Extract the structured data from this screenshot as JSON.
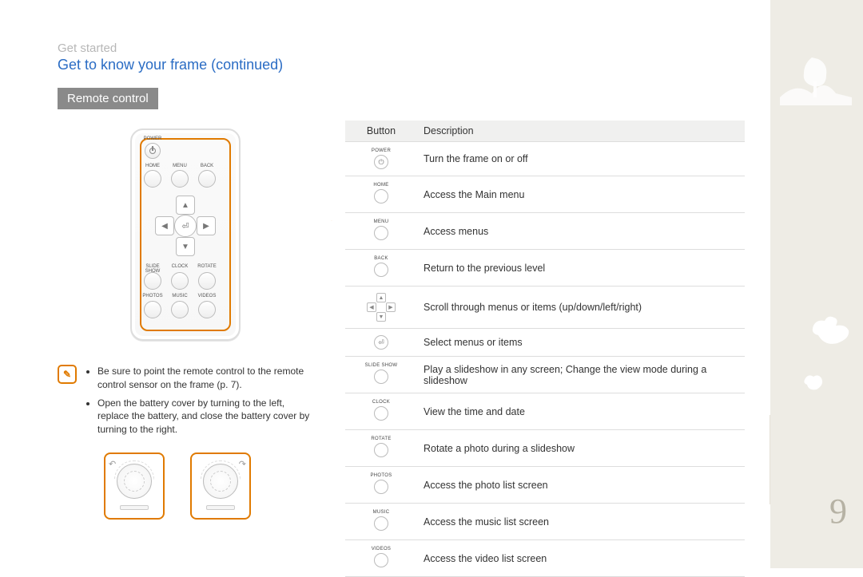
{
  "eyebrow": "Get started",
  "title": "Get to know your frame  (continued)",
  "section": "Remote control",
  "note_icon": "✎",
  "notes": [
    "Be sure to point the remote control to the remote control sensor on the frame (p. 7).",
    "Open the battery cover by turning to the left, replace the battery, and close the battery cover by turning to the right."
  ],
  "table": {
    "head_button": "Button",
    "head_desc": "Description",
    "rows": [
      {
        "label": "POWER",
        "icon": "⏻",
        "desc": "Turn the frame on or off"
      },
      {
        "label": "HOME",
        "icon": "",
        "desc": "Access the Main menu"
      },
      {
        "label": "MENU",
        "icon": "",
        "desc": "Access menus"
      },
      {
        "label": "BACK",
        "icon": "",
        "desc": "Return to the previous level"
      },
      {
        "label": "",
        "icon": "dpad",
        "desc": "Scroll through menus or items (up/down/left/right)"
      },
      {
        "label": "",
        "icon": "⏎",
        "desc": "Select menus or items"
      },
      {
        "label": "SLIDE SHOW",
        "icon": "",
        "desc": "Play a slideshow in any screen; Change the view mode during a slideshow"
      },
      {
        "label": "CLOCK",
        "icon": "",
        "desc": "View the time and date"
      },
      {
        "label": "ROTATE",
        "icon": "",
        "desc": "Rotate a photo during a slideshow"
      },
      {
        "label": "PHOTOS",
        "icon": "",
        "desc": "Access the photo list screen"
      },
      {
        "label": "MUSIC",
        "icon": "",
        "desc": "Access the music list screen"
      },
      {
        "label": "VIDEOS",
        "icon": "",
        "desc": "Access the video list screen"
      }
    ]
  },
  "remote_labels": {
    "power": "POWER",
    "home": "HOME",
    "menu": "MENU",
    "back": "BACK",
    "slideshow": "SLIDE SHOW",
    "clock": "CLOCK",
    "rotate": "ROTATE",
    "photos": "PHOTOS",
    "music": "MUSIC",
    "videos": "VIDEOS"
  },
  "page_number": "9"
}
